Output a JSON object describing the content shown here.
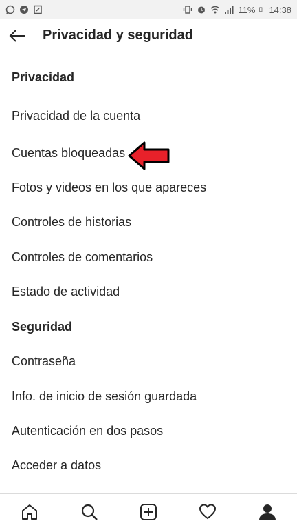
{
  "status": {
    "battery": "11%",
    "time": "14:38",
    "left_icons": [
      "whatsapp-icon",
      "telegram-icon",
      "store-icon"
    ],
    "right_icons": [
      "vibrate-icon",
      "alarm-icon",
      "wifi-icon",
      "signal-icon",
      "battery-icon"
    ]
  },
  "header": {
    "title": "Privacidad y seguridad",
    "back_icon": "back-arrow-icon"
  },
  "sections": {
    "privacy_title": "Privacidad",
    "security_title": "Seguridad"
  },
  "items": {
    "privacy_account": "Privacidad de la cuenta",
    "blocked_accounts": "Cuentas bloqueadas",
    "photos_videos": "Fotos y videos en los que apareces",
    "story_controls": "Controles de historias",
    "comment_controls": "Controles de comentarios",
    "activity_status": "Estado de actividad",
    "password": "Contraseña",
    "saved_login": "Info. de inicio de sesión guardada",
    "two_factor": "Autenticación en dos pasos",
    "data_access": "Acceder a datos"
  },
  "annotation": {
    "arrow_color": "#e8212a"
  },
  "bottom_nav": [
    "home-icon",
    "search-icon",
    "add-post-icon",
    "activity-heart-icon",
    "profile-icon"
  ]
}
